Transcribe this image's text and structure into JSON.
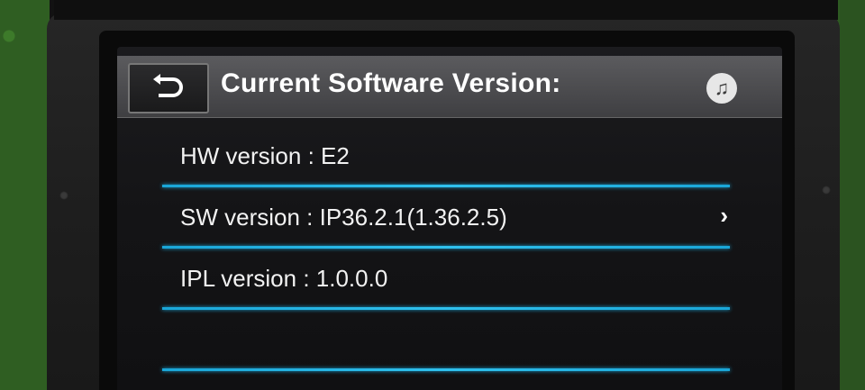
{
  "header": {
    "title": "Current Software Version:",
    "back_icon": "back-arrow-icon",
    "music_icon": "music-note-icon",
    "music_glyph": "♫"
  },
  "versions": [
    {
      "label": "HW version : E2",
      "has_chevron": false
    },
    {
      "label": "SW version : IP36.2.1(1.36.2.5)",
      "has_chevron": true
    },
    {
      "label": "IPL version : 1.0.0.0",
      "has_chevron": false
    },
    {
      "label": "",
      "has_chevron": false
    }
  ],
  "chevron_glyph": "›",
  "colors": {
    "accent_line": "#1aa6d8",
    "title_bar": "#4a4a4d",
    "screen_bg": "#151517"
  }
}
